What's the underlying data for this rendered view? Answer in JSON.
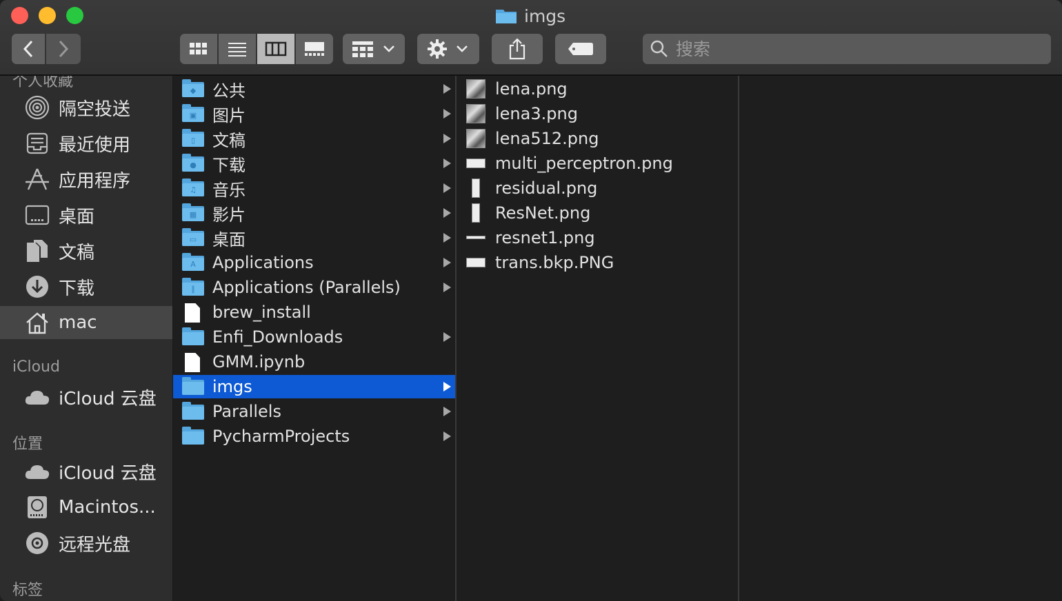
{
  "window": {
    "title": "imgs"
  },
  "toolbar": {
    "search_placeholder": "搜索"
  },
  "sidebar": {
    "sections": [
      {
        "label": "个人收藏"
      },
      {
        "label": "iCloud"
      },
      {
        "label": "位置"
      },
      {
        "label": "标签"
      }
    ],
    "favorites": [
      {
        "label": "隔空投送",
        "icon": "airdrop-icon"
      },
      {
        "label": "最近使用",
        "icon": "recents-icon"
      },
      {
        "label": "应用程序",
        "icon": "applications-icon"
      },
      {
        "label": "桌面",
        "icon": "desktop-icon"
      },
      {
        "label": "文稿",
        "icon": "documents-icon"
      },
      {
        "label": "下载",
        "icon": "downloads-icon"
      },
      {
        "label": "mac",
        "icon": "home-icon",
        "selected": true
      }
    ],
    "icloud": [
      {
        "label": "iCloud 云盘",
        "icon": "cloud-icon"
      }
    ],
    "locations": [
      {
        "label": "iCloud 云盘",
        "icon": "cloud-icon"
      },
      {
        "label": "Macintos...",
        "icon": "hard-drive-icon"
      },
      {
        "label": "远程光盘",
        "icon": "disc-icon"
      }
    ]
  },
  "column1": {
    "items": [
      {
        "label": "公共",
        "kind": "folder",
        "glyph": "◆",
        "has_children": true
      },
      {
        "label": "图片",
        "kind": "folder",
        "glyph": "▣",
        "has_children": true
      },
      {
        "label": "文稿",
        "kind": "folder",
        "glyph": "▯",
        "has_children": true
      },
      {
        "label": "下载",
        "kind": "folder",
        "glyph": "●",
        "has_children": true
      },
      {
        "label": "音乐",
        "kind": "folder",
        "glyph": "♫",
        "has_children": true
      },
      {
        "label": "影片",
        "kind": "folder",
        "glyph": "▦",
        "has_children": true
      },
      {
        "label": "桌面",
        "kind": "folder",
        "glyph": "▭",
        "has_children": true
      },
      {
        "label": "Applications",
        "kind": "folder",
        "glyph": "A",
        "has_children": true
      },
      {
        "label": "Applications (Parallels)",
        "kind": "folder",
        "glyph": "∥",
        "has_children": true
      },
      {
        "label": "brew_install",
        "kind": "file",
        "has_children": false
      },
      {
        "label": "Enfi_Downloads",
        "kind": "folder",
        "glyph": "",
        "has_children": true
      },
      {
        "label": "GMM.ipynb",
        "kind": "file",
        "has_children": false
      },
      {
        "label": "imgs",
        "kind": "folder",
        "glyph": "",
        "has_children": true,
        "selected": true
      },
      {
        "label": "Parallels",
        "kind": "folder",
        "glyph": "",
        "has_children": true
      },
      {
        "label": "PycharmProjects",
        "kind": "folder",
        "glyph": "",
        "has_children": true
      }
    ]
  },
  "column2": {
    "items": [
      {
        "label": "lena.png",
        "thumb": "photo"
      },
      {
        "label": "lena3.png",
        "thumb": "photo"
      },
      {
        "label": "lena512.png",
        "thumb": "photo"
      },
      {
        "label": "multi_perceptron.png",
        "thumb": "wide"
      },
      {
        "label": "residual.png",
        "thumb": "tall"
      },
      {
        "label": "ResNet.png",
        "thumb": "tall"
      },
      {
        "label": "resnet1.png",
        "thumb": "strip"
      },
      {
        "label": "trans.bkp.PNG",
        "thumb": "wide"
      }
    ]
  },
  "colors": {
    "selection": "#0e5ad4",
    "folder": "#6cbcee",
    "sidebar_bg": "#2d2d2d",
    "content_bg": "#1e1e1e"
  }
}
